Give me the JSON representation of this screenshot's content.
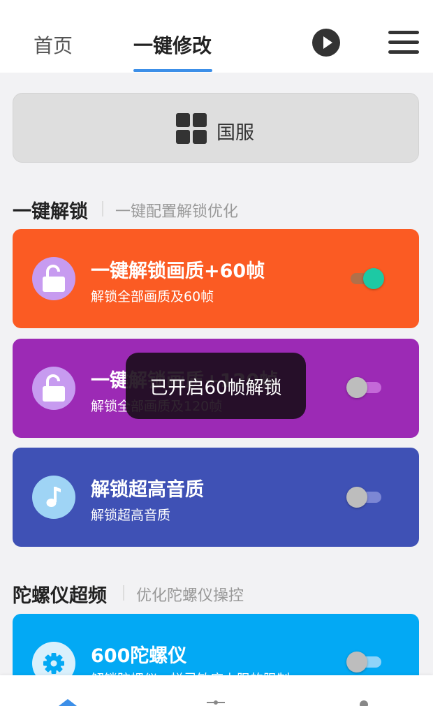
{
  "header": {
    "tabs": [
      {
        "label": "首页"
      },
      {
        "label": "一键修改"
      }
    ]
  },
  "server_button": {
    "label": "国服",
    "icon": "grid-icon"
  },
  "sections": [
    {
      "title": "一键解锁",
      "subtitle": "一键配置解锁优化"
    },
    {
      "title": "陀螺仪超频",
      "subtitle": "优化陀螺仪操控"
    }
  ],
  "cards": [
    {
      "title": "一键解锁画质+60帧",
      "desc": "解锁全部画质及60帧",
      "color": "#fb5b23",
      "icon": "unlock-icon",
      "on": true
    },
    {
      "title": "一键解锁画质+120帧",
      "desc": "解锁全部画质及120帧",
      "color": "#9c2ab5",
      "icon": "unlock-icon",
      "on": false
    },
    {
      "title": "解锁超高音质",
      "desc": "解锁超高音质",
      "color": "#3f51b5",
      "icon": "music-note-icon",
      "on": false
    },
    {
      "title": "600陀螺仪",
      "desc": "解锁陀螺仪一栏灵敏度上限的限制",
      "color": "#03a9f4",
      "icon": "gear-icon",
      "on": false
    }
  ],
  "toast": {
    "text": "已开启60帧解锁"
  },
  "colors": {
    "accent": "#3c8fe8",
    "toggle_on": "#1dc9a4"
  }
}
